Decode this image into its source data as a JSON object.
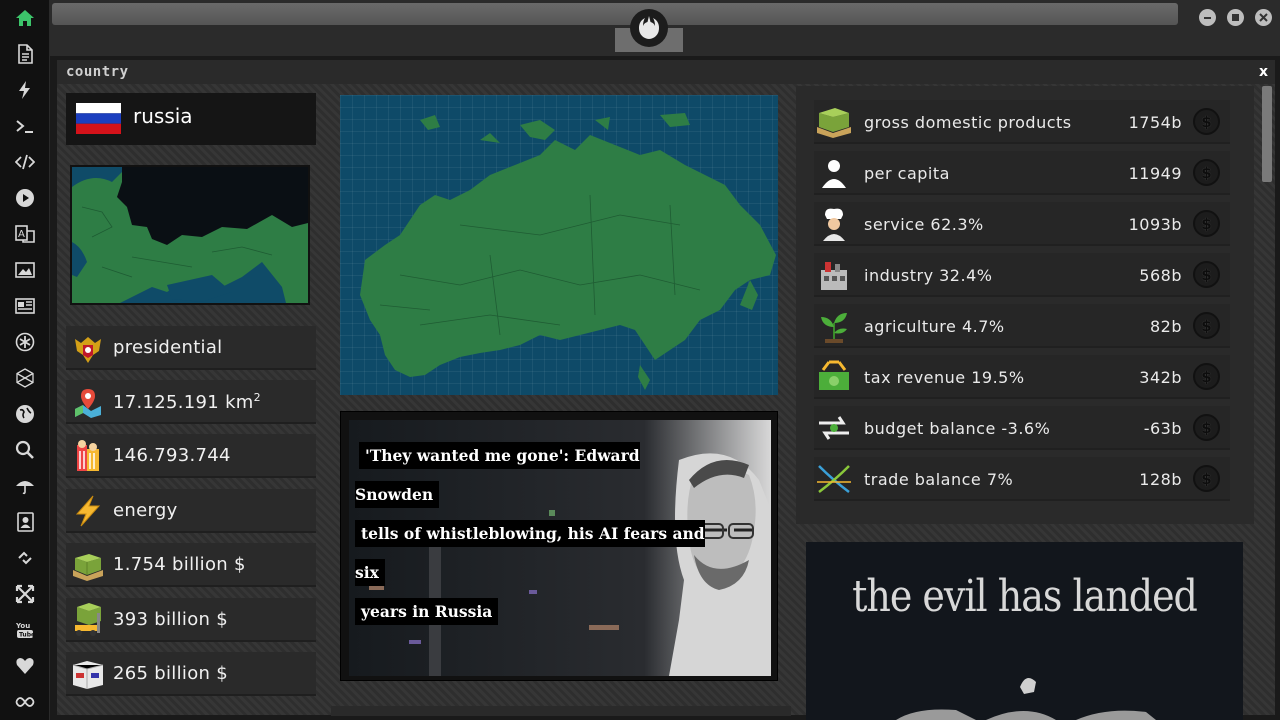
{
  "panel": {
    "title": "country",
    "close": "x"
  },
  "country": {
    "name": "russia"
  },
  "info": [
    {
      "icon": "coat-of-arms-icon",
      "text": "presidential"
    },
    {
      "icon": "map-pin-icon",
      "text": "17.125.191 km",
      "sup": "2"
    },
    {
      "icon": "population-icon",
      "text": "146.793.744"
    },
    {
      "icon": "energy-bolt-icon",
      "text": "energy"
    },
    {
      "icon": "money-stack-icon",
      "text": "1.754 billion $"
    },
    {
      "icon": "export-forklift-icon",
      "text": "393 billion $"
    },
    {
      "icon": "import-boxes-icon",
      "text": "265 billion $"
    }
  ],
  "news": {
    "headline_1": "'They wanted me gone': Edward Snowden",
    "headline_2": "tells of whistleblowing, his AI fears and six",
    "headline_3": "years in Russia"
  },
  "stats": [
    {
      "icon": "money-stack-icon",
      "label": "gross domestic products",
      "value": "1754b"
    },
    {
      "icon": "person-icon",
      "label": "per capita",
      "value": "11949"
    },
    {
      "icon": "chef-icon",
      "label": "service 62.3%",
      "value": "1093b"
    },
    {
      "icon": "factory-icon",
      "label": "industry 32.4%",
      "value": "568b"
    },
    {
      "icon": "plant-icon",
      "label": "agriculture 4.7%",
      "value": "82b"
    },
    {
      "icon": "tax-money-icon",
      "label": "tax revenue 19.5%",
      "value": "342b"
    },
    {
      "icon": "balance-arrows-icon",
      "label": "budget balance -3.6%",
      "value": "-63b"
    },
    {
      "icon": "trade-cross-icon",
      "label": "trade balance 7%",
      "value": "128b"
    }
  ],
  "currency_symbol": "$",
  "poster": {
    "title": "the evil has landed"
  },
  "colors": {
    "map_sea": "#0e4a68",
    "map_land": "#2e7d45",
    "panel_bg": "#333333"
  }
}
